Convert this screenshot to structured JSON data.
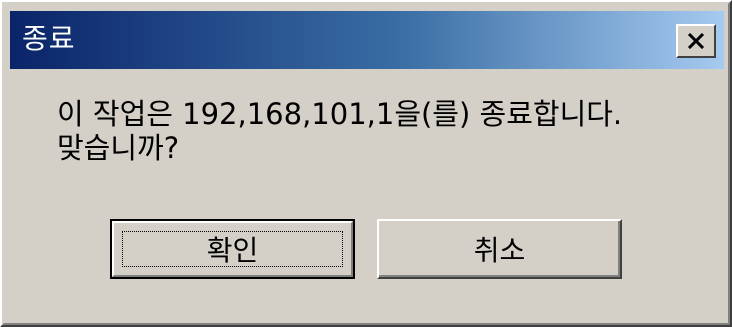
{
  "window": {
    "title": "종료"
  },
  "titlebar": {
    "close_icon": "close-x-icon"
  },
  "message": {
    "line1": "이 작업은 192,168,101,1을(를) 종료합니다.",
    "line2": "맞습니까?"
  },
  "buttons": {
    "ok_label": "확인",
    "cancel_label": "취소"
  },
  "colors": {
    "titlebar_start": "#0a246a",
    "titlebar_end": "#a6caf0",
    "face": "#d4d0c8"
  }
}
